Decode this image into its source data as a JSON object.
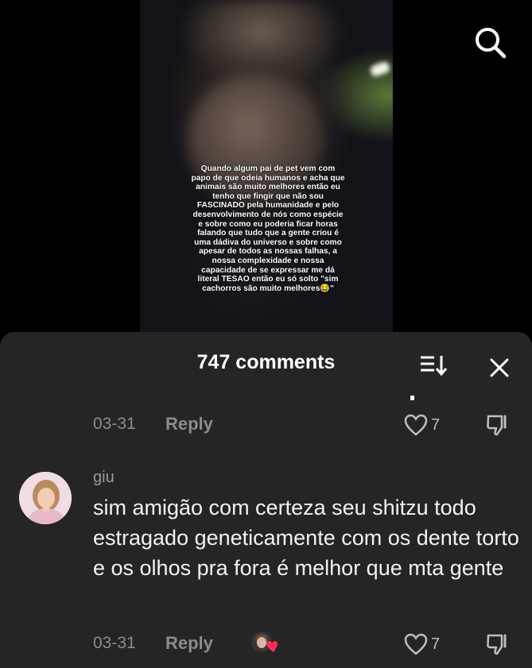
{
  "video": {
    "overlay_text": "Quando algum pai de pet vem com\npapo de que odeia humanos e acha que\nanimais são muito melhores então eu\ntenho que fingir que não sou\nFASCINADO pela humanidade e pelo\ndesenvolvimento de nós como espécie\ne sobre como eu poderia ficar horas\nfalando que tudo que a gente criou é\numa dádiva do universo e sobre como\napesar de todos as nossas falhas, a\nnossa complexidade e nossa\ncapacidade de se expressar me dá\nliteral TESAO então eu só solto \"sim\ncachorros são muito melhores😂\"",
    "search_icon": "search-icon"
  },
  "comments_panel": {
    "title": "747 comments",
    "sort_icon": "sort-icon",
    "close_icon": "close-icon"
  },
  "comments": [
    {
      "date": "03-31",
      "reply_label": "Reply",
      "likes": "7"
    },
    {
      "username": "giu",
      "text": "sim amigão com certeza seu shitzu todo estragado geneticamente com os dente torto e os olhos pra fora é melhor que mta gente",
      "date": "03-31",
      "reply_label": "Reply",
      "likes": "7"
    }
  ],
  "colors": {
    "panel_bg": "#252525",
    "muted_text": "#8c8c8c",
    "liked_heart": "#ff2d55"
  }
}
